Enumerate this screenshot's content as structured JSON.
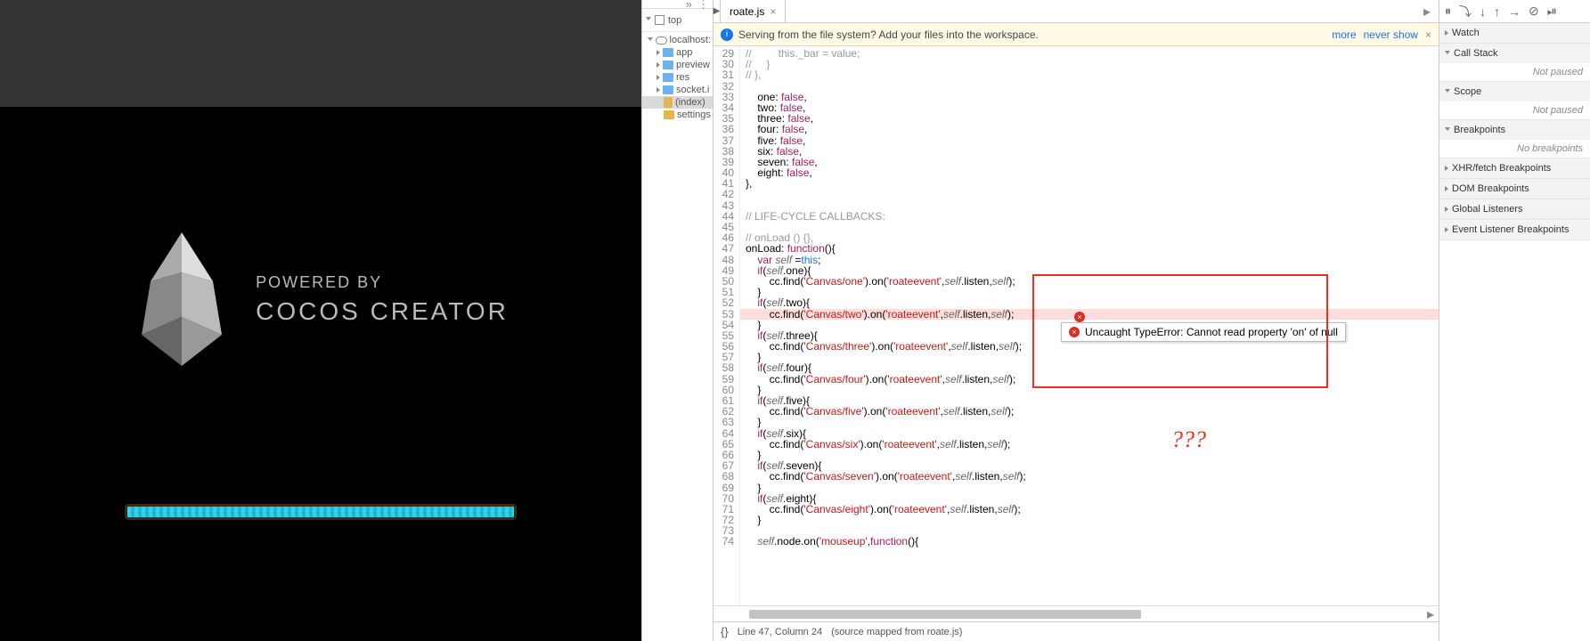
{
  "game": {
    "powered": "POWERED BY",
    "title": "COCOS CREATOR"
  },
  "sources": {
    "top": "top",
    "host": "localhost:",
    "folders": [
      "app",
      "preview",
      "res",
      "socket.i"
    ],
    "files": [
      "(index)",
      "settings"
    ]
  },
  "editor": {
    "tab": "roate.js",
    "info": "Serving from the file system? Add your files into the workspace.",
    "more": "more",
    "never": "never show",
    "lines": [
      {
        "n": 29,
        "html": "<span class='c-cmt'>//         this._bar = value;</span>"
      },
      {
        "n": 30,
        "html": "<span class='c-cmt'>//     }</span>"
      },
      {
        "n": 31,
        "html": "<span class='c-cmt'>// },</span>"
      },
      {
        "n": 32,
        "html": ""
      },
      {
        "n": 33,
        "html": "    one: <span class='c-kw'>false</span>,"
      },
      {
        "n": 34,
        "html": "    two: <span class='c-kw'>false</span>,"
      },
      {
        "n": 35,
        "html": "    three: <span class='c-kw'>false</span>,"
      },
      {
        "n": 36,
        "html": "    four: <span class='c-kw'>false</span>,"
      },
      {
        "n": 37,
        "html": "    five: <span class='c-kw'>false</span>,"
      },
      {
        "n": 38,
        "html": "    six: <span class='c-kw'>false</span>,"
      },
      {
        "n": 39,
        "html": "    seven: <span class='c-kw'>false</span>,"
      },
      {
        "n": 40,
        "html": "    eight: <span class='c-kw'>false</span>,"
      },
      {
        "n": 41,
        "html": "},"
      },
      {
        "n": 42,
        "html": ""
      },
      {
        "n": 43,
        "html": ""
      },
      {
        "n": 44,
        "html": "<span class='c-cmt'>// LIFE-CYCLE CALLBACKS:</span>"
      },
      {
        "n": 45,
        "html": ""
      },
      {
        "n": 46,
        "html": "<span class='c-cmt'>// onLoad () {},</span>"
      },
      {
        "n": 47,
        "html": "onLoad: <span class='c-kw'>function</span>(){"
      },
      {
        "n": 48,
        "html": "    <span class='c-kw'>var</span> <span class='c-id'>self</span> =<span class='c-this'>this</span>;"
      },
      {
        "n": 49,
        "html": "    <span class='c-kw'>if</span>(<span class='c-id'>self</span>.one){"
      },
      {
        "n": 50,
        "html": "        cc.find(<span class='c-str'>'Canvas/one'</span>).on(<span class='c-str'>'roateevent'</span>,<span class='c-id'>self</span>.listen,<span class='c-id'>self</span>);"
      },
      {
        "n": 51,
        "html": "    }"
      },
      {
        "n": 52,
        "html": "    <span class='c-kw'>if</span>(<span class='c-id'>self</span>.two){"
      },
      {
        "n": 53,
        "html": "        cc.find(<span class='c-str'>'Canvas/two'</span>).on(<span class='c-str'>'roateevent'</span>,<span class='c-id'>self</span>.listen,<span class='c-id'>self</span>);",
        "err": true
      },
      {
        "n": 54,
        "html": "    }"
      },
      {
        "n": 55,
        "html": "    <span class='c-kw'>if</span>(<span class='c-id'>self</span>.three){"
      },
      {
        "n": 56,
        "html": "        cc.find(<span class='c-str'>'Canvas/three'</span>).on(<span class='c-str'>'roateevent'</span>,<span class='c-id'>self</span>.listen,<span class='c-id'>self</span>);"
      },
      {
        "n": 57,
        "html": "    }"
      },
      {
        "n": 58,
        "html": "    <span class='c-kw'>if</span>(<span class='c-id'>self</span>.four){"
      },
      {
        "n": 59,
        "html": "        cc.find(<span class='c-str'>'Canvas/four'</span>).on(<span class='c-str'>'roateevent'</span>,<span class='c-id'>self</span>.listen,<span class='c-id'>self</span>);"
      },
      {
        "n": 60,
        "html": "    }"
      },
      {
        "n": 61,
        "html": "    <span class='c-kw'>if</span>(<span class='c-id'>self</span>.five){"
      },
      {
        "n": 62,
        "html": "        cc.find(<span class='c-str'>'Canvas/five'</span>).on(<span class='c-str'>'roateevent'</span>,<span class='c-id'>self</span>.listen,<span class='c-id'>self</span>);"
      },
      {
        "n": 63,
        "html": "    }"
      },
      {
        "n": 64,
        "html": "    <span class='c-kw'>if</span>(<span class='c-id'>self</span>.six){"
      },
      {
        "n": 65,
        "html": "        cc.find(<span class='c-str'>'Canvas/six'</span>).on(<span class='c-str'>'roateevent'</span>,<span class='c-id'>self</span>.listen,<span class='c-id'>self</span>);"
      },
      {
        "n": 66,
        "html": "    }"
      },
      {
        "n": 67,
        "html": "    <span class='c-kw'>if</span>(<span class='c-id'>self</span>.seven){"
      },
      {
        "n": 68,
        "html": "        cc.find(<span class='c-str'>'Canvas/seven'</span>).on(<span class='c-str'>'roateevent'</span>,<span class='c-id'>self</span>.listen,<span class='c-id'>self</span>);"
      },
      {
        "n": 69,
        "html": "    }"
      },
      {
        "n": 70,
        "html": "    <span class='c-kw'>if</span>(<span class='c-id'>self</span>.eight){"
      },
      {
        "n": 71,
        "html": "        cc.find(<span class='c-str'>'Canvas/eight'</span>).on(<span class='c-str'>'roateevent'</span>,<span class='c-id'>self</span>.listen,<span class='c-id'>self</span>);"
      },
      {
        "n": 72,
        "html": "    }"
      },
      {
        "n": 73,
        "html": ""
      },
      {
        "n": 74,
        "html": "    <span class='c-id'>self</span>.node.on(<span class='c-str'>'mouseup'</span>,<span class='c-kw'>function</span>(){"
      }
    ],
    "error_tooltip": "Uncaught TypeError: Cannot read property 'on' of null",
    "qmarks": "???",
    "status_pos": "Line 47, Column 24",
    "status_map": "(source mapped from roate.js)"
  },
  "debugger": {
    "sections": [
      "Watch",
      "Call Stack",
      "Scope",
      "Breakpoints",
      "XHR/fetch Breakpoints",
      "DOM Breakpoints",
      "Global Listeners",
      "Event Listener Breakpoints"
    ],
    "not_paused": "Not paused",
    "no_bp": "No breakpoints"
  }
}
